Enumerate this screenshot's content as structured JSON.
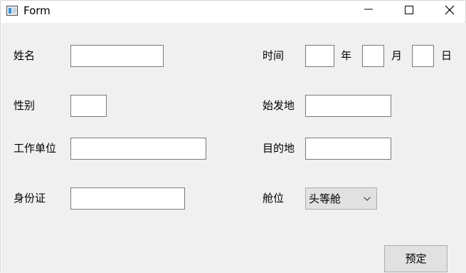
{
  "window": {
    "title": "Form"
  },
  "form": {
    "name_label": "姓名",
    "gender_label": "性别",
    "work_unit_label": "工作单位",
    "id_label": "身份证",
    "time_label": "时间",
    "year_label": "年",
    "month_label": "月",
    "day_label": "日",
    "origin_label": "始发地",
    "destination_label": "目的地",
    "cabin_label": "舱位",
    "cabin_selected": "头等舱",
    "book_button": "预定"
  },
  "inputs": {
    "name": "",
    "gender": "",
    "work_unit": "",
    "id": "",
    "year": "",
    "month": "",
    "day": "",
    "origin": "",
    "destination": ""
  }
}
